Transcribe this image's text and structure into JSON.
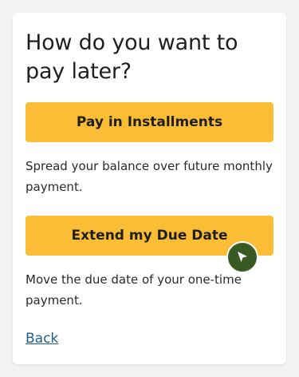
{
  "card": {
    "title": "How do you want to pay later?"
  },
  "options": [
    {
      "label": "Pay in Installments",
      "description": "Spread your balance over future monthly payment."
    },
    {
      "label": "Extend my Due Date",
      "description": "Move the due date of your one-time payment."
    }
  ],
  "back": {
    "label": "Back"
  },
  "cursor": {
    "icon": "pointer-cursor-icon"
  },
  "colors": {
    "button_bg": "#fbbd36",
    "link": "#1f5f8b",
    "cursor_badge": "#3a5a24"
  }
}
